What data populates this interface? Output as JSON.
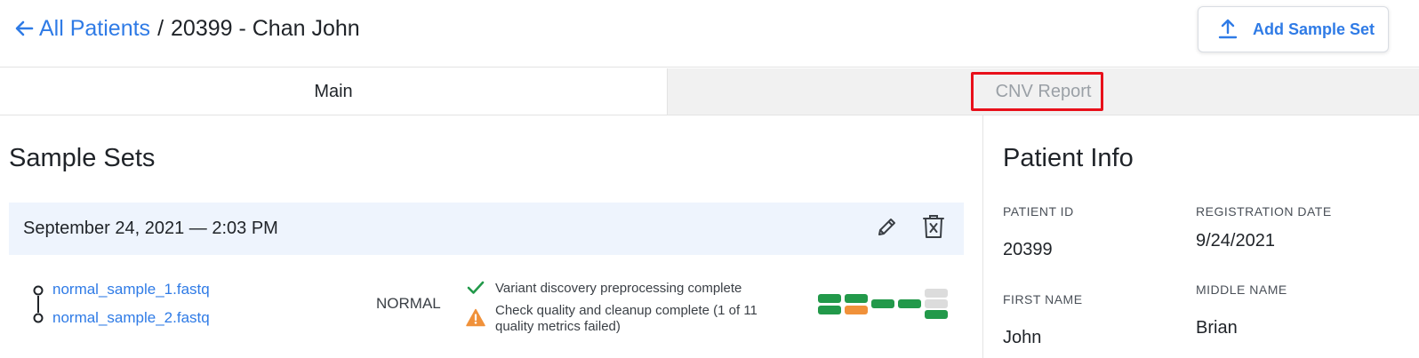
{
  "header": {
    "back_label": "All Patients",
    "separator": "/",
    "current_patient": "20399 - Chan John",
    "add_sample_set_label": "Add Sample Set"
  },
  "tabs": [
    {
      "label": "Main",
      "active": true
    },
    {
      "label": "CNV Report",
      "active": false,
      "highlighted": true
    }
  ],
  "sample_sets": {
    "title": "Sample Sets",
    "sets": [
      {
        "date": "September 24, 2021 — 2:03 PM",
        "files": [
          "normal_sample_1.fastq",
          "normal_sample_2.fastq"
        ],
        "type": "NORMAL",
        "statuses": [
          {
            "icon": "check-icon",
            "state": "success",
            "text": "Variant discovery preprocessing complete"
          },
          {
            "icon": "warning-icon",
            "state": "warning",
            "text": "Check quality and cleanup complete (1 of 11 quality metrics failed)"
          }
        ],
        "quality_metrics": {
          "total": 11,
          "failed": 1,
          "pending": 3,
          "colors": {
            "passed": "#22994a",
            "failed": "#f0913a",
            "pending": "#dcdcdc"
          }
        }
      }
    ]
  },
  "patient_info": {
    "title": "Patient Info",
    "fields": [
      {
        "label": "PATIENT ID",
        "value": "20399"
      },
      {
        "label": "REGISTRATION DATE",
        "value": "9/24/2021"
      },
      {
        "label": "FIRST NAME",
        "value": "John"
      },
      {
        "label": "MIDDLE NAME",
        "value": "Brian"
      }
    ]
  },
  "colors": {
    "accent": "#2f7be6",
    "highlight": "#e8101a",
    "set_row_bg": "#eef4fd",
    "success": "#22994a",
    "warning": "#f0913a"
  }
}
